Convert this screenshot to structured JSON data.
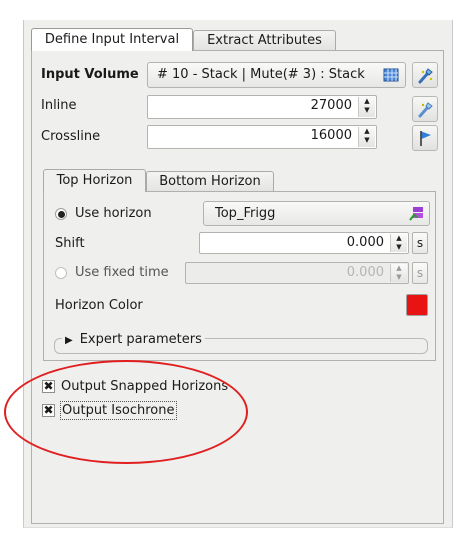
{
  "tabs": {
    "define_input_interval": "Define Input Interval",
    "extract_attributes": "Extract Attributes"
  },
  "input_volume": {
    "label": "Input Volume",
    "value": "# 10 - Stack | Mute(# 3) : Stack"
  },
  "inline": {
    "label": "Inline",
    "value": "27000"
  },
  "crossline": {
    "label": "Crossline",
    "value": "16000"
  },
  "horizon_tabs": {
    "top": "Top Horizon",
    "bottom": "Bottom Horizon"
  },
  "use_horizon": {
    "label": "Use horizon",
    "value": "Top_Frigg"
  },
  "shift": {
    "label": "Shift",
    "value": "0.000",
    "unit": "s"
  },
  "use_fixed_time": {
    "label": "Use fixed time",
    "value": "0.000",
    "unit": "s"
  },
  "horizon_color": {
    "label": "Horizon Color",
    "color": "#e81414"
  },
  "expert_parameters": "Expert parameters",
  "output_snapped": {
    "label": "Output Snapped Horizons",
    "checked": true
  },
  "output_isochrone": {
    "label": "Output Isochrone",
    "checked": true
  },
  "colors": {
    "annotation": "#e02020",
    "panel": "#efefee"
  }
}
